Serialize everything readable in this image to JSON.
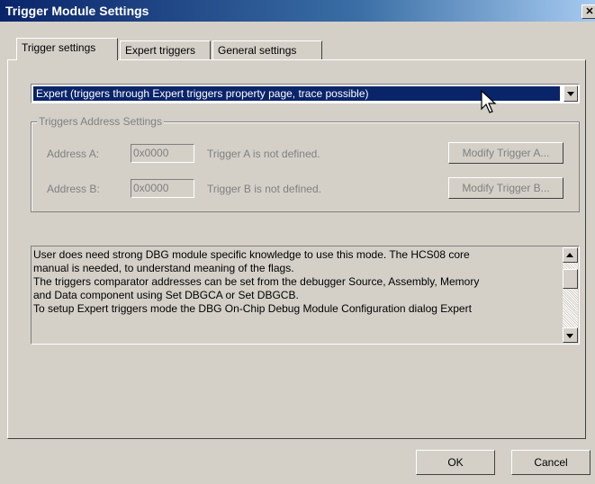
{
  "window": {
    "title": "Trigger Module Settings",
    "close_glyph": "✕"
  },
  "tabs": [
    {
      "label": "Trigger settings",
      "active": true
    },
    {
      "label": "Expert triggers",
      "active": false
    },
    {
      "label": "General settings",
      "active": false
    }
  ],
  "mode_select": {
    "value": "Expert (triggers through Expert triggers property page, trace possible)"
  },
  "address_group": {
    "legend": "Triggers Address Settings",
    "rows": [
      {
        "label": "Address A:",
        "value": "0x0000",
        "status": "Trigger A is not defined.",
        "button": "Modify Trigger A..."
      },
      {
        "label": "Address B:",
        "value": "0x0000",
        "status": "Trigger B is not defined.",
        "button": "Modify Trigger B..."
      }
    ]
  },
  "description": {
    "lines": [
      "User does need strong DBG module specific knowledge to use this mode. The HCS08 core",
      "manual is needed, to understand meaning of the flags.",
      "The triggers comparator addresses can be set from the debugger Source, Assembly, Memory",
      "and Data component using Set DBGCA or Set DBGCB.",
      "To setup Expert triggers mode the DBG On-Chip Debug Module Configuration dialog Expert"
    ]
  },
  "buttons": {
    "ok": "OK",
    "cancel": "Cancel"
  },
  "colors": {
    "titlebar": "#0a246a",
    "selection": "#0a246a",
    "face": "#d4d0c8"
  }
}
